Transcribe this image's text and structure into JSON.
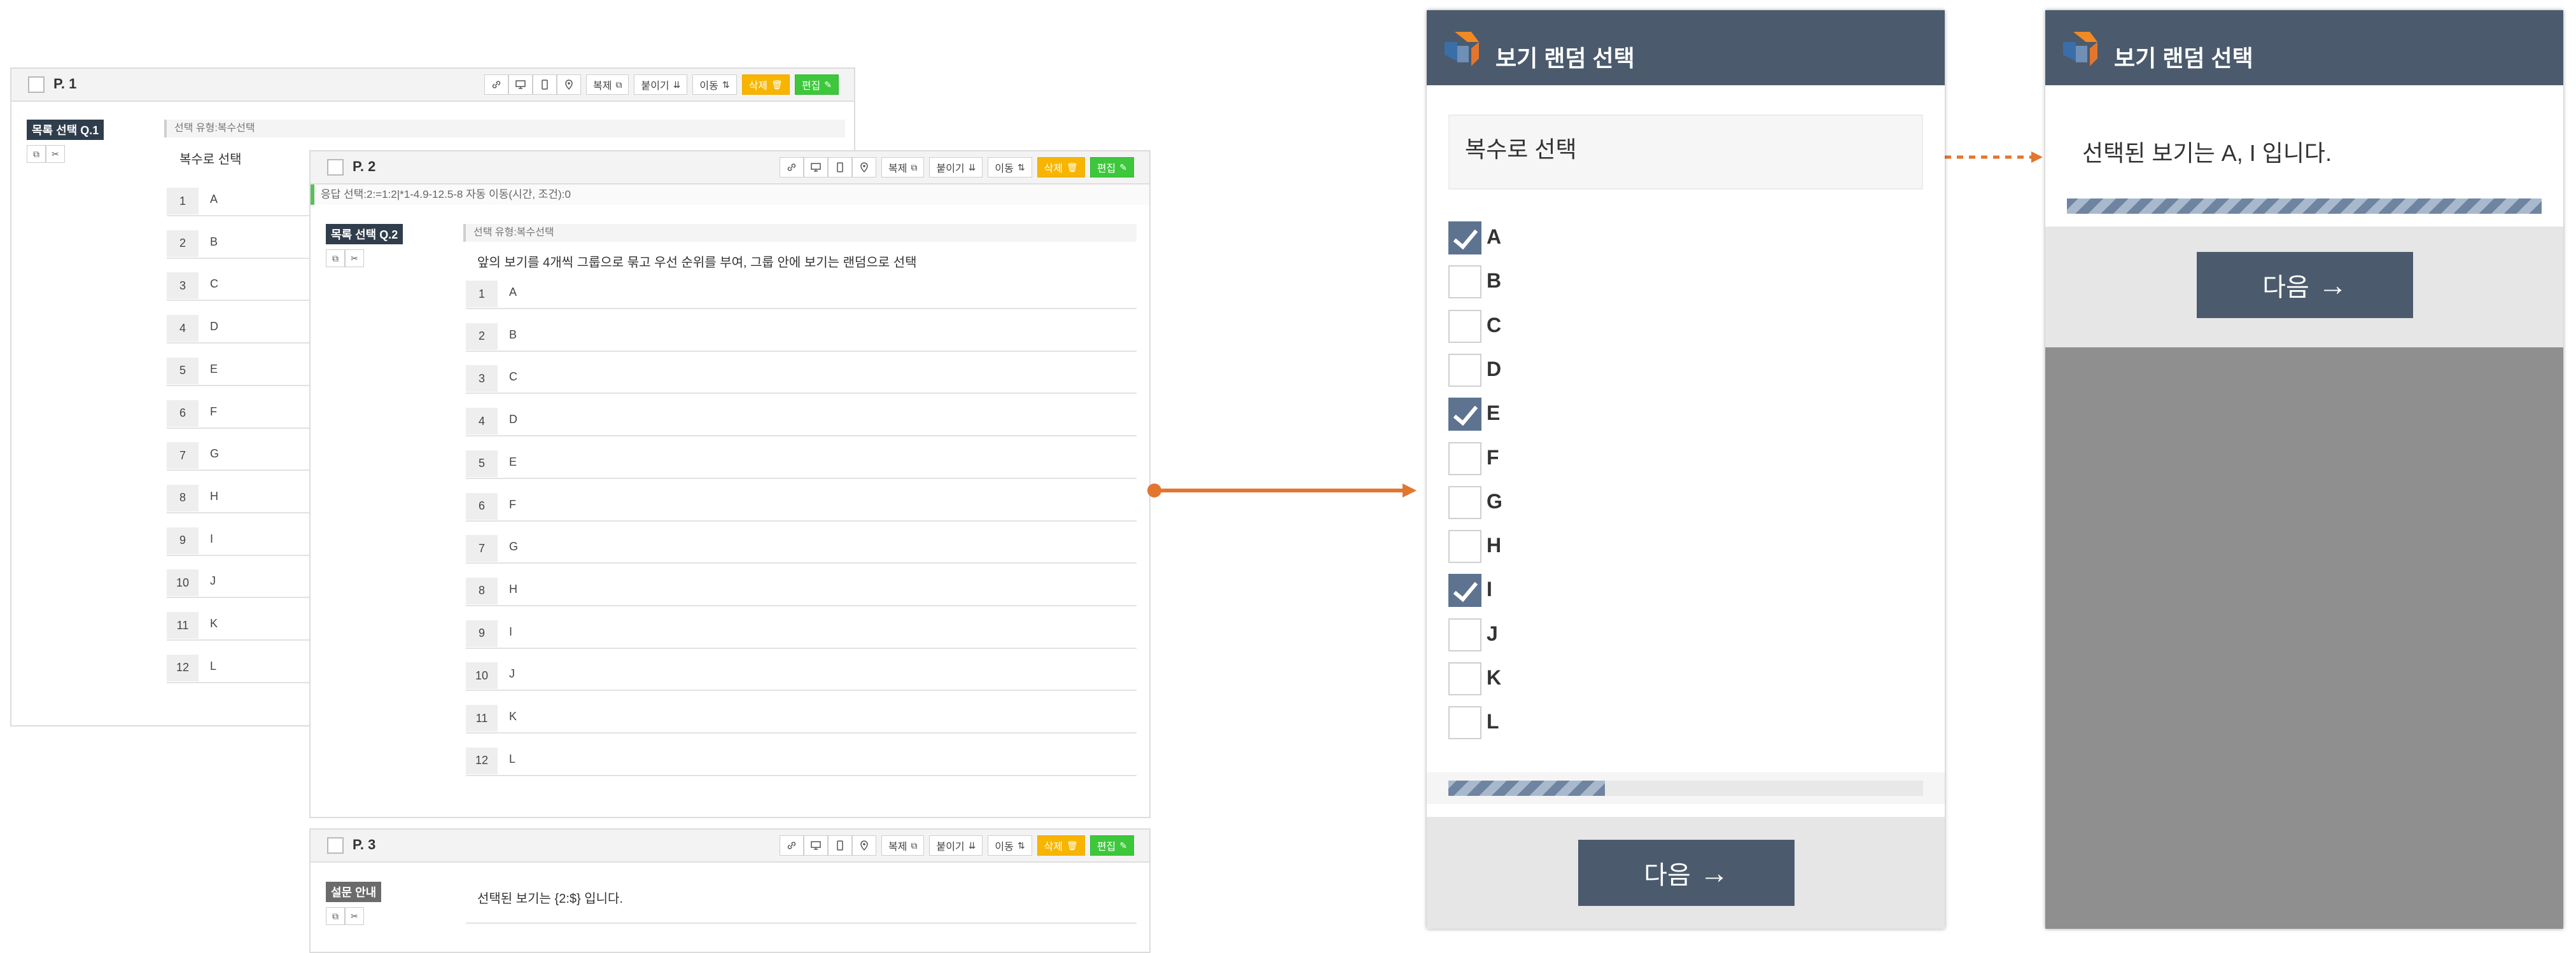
{
  "colors": {
    "header_dark": "#4b5b6d",
    "checkbox_checked": "#5d7390",
    "delete_button": "#f7b500",
    "edit_button": "#3dc83b",
    "connector": "#e2762f",
    "badge": "#2f3d4c"
  },
  "toolbar": {
    "copy_label": "복제",
    "paste_label": "붙이기",
    "move_label": "이동",
    "delete_label": "삭제",
    "edit_label": "편집"
  },
  "page1": {
    "title": "P. 1",
    "badge": "목록 선택 Q.1",
    "type_label": "선택 유형:복수선택",
    "question": "복수로 선택",
    "options": [
      "A",
      "B",
      "C",
      "D",
      "E",
      "F",
      "G",
      "H",
      "I",
      "J",
      "K",
      "L"
    ]
  },
  "page2": {
    "title": "P. 2",
    "route_info": "응답 선택:2:=1:2|*1-4.9-12.5-8    자동 이동(시간, 조건):0",
    "badge": "목록 선택 Q.2",
    "type_label": "선택 유형:복수선택",
    "question": "앞의 보기를 4개씩 그룹으로 묶고 우선 순위를 부여, 그룹 안에 보기는 랜덤으로 선택",
    "options": [
      "A",
      "B",
      "C",
      "D",
      "E",
      "F",
      "G",
      "H",
      "I",
      "J",
      "K",
      "L"
    ]
  },
  "page3": {
    "title": "P. 3",
    "badge": "설문 안내",
    "text": "선택된 보기는 {2:$} 입니다."
  },
  "preview1": {
    "title": "보기 랜덤 선택",
    "question": "복수로 선택",
    "options": [
      {
        "label": "A",
        "checked": true
      },
      {
        "label": "B",
        "checked": false
      },
      {
        "label": "C",
        "checked": false
      },
      {
        "label": "D",
        "checked": false
      },
      {
        "label": "E",
        "checked": true
      },
      {
        "label": "F",
        "checked": false
      },
      {
        "label": "G",
        "checked": false
      },
      {
        "label": "H",
        "checked": false
      },
      {
        "label": "I",
        "checked": true
      },
      {
        "label": "J",
        "checked": false
      },
      {
        "label": "K",
        "checked": false
      },
      {
        "label": "L",
        "checked": false
      }
    ],
    "progress": 0.33,
    "next_label": "다음"
  },
  "preview2": {
    "title": "보기 랜덤 선택",
    "message": "선택된 보기는 A, I 입니다.",
    "progress": 1.0,
    "next_label": "다음"
  }
}
